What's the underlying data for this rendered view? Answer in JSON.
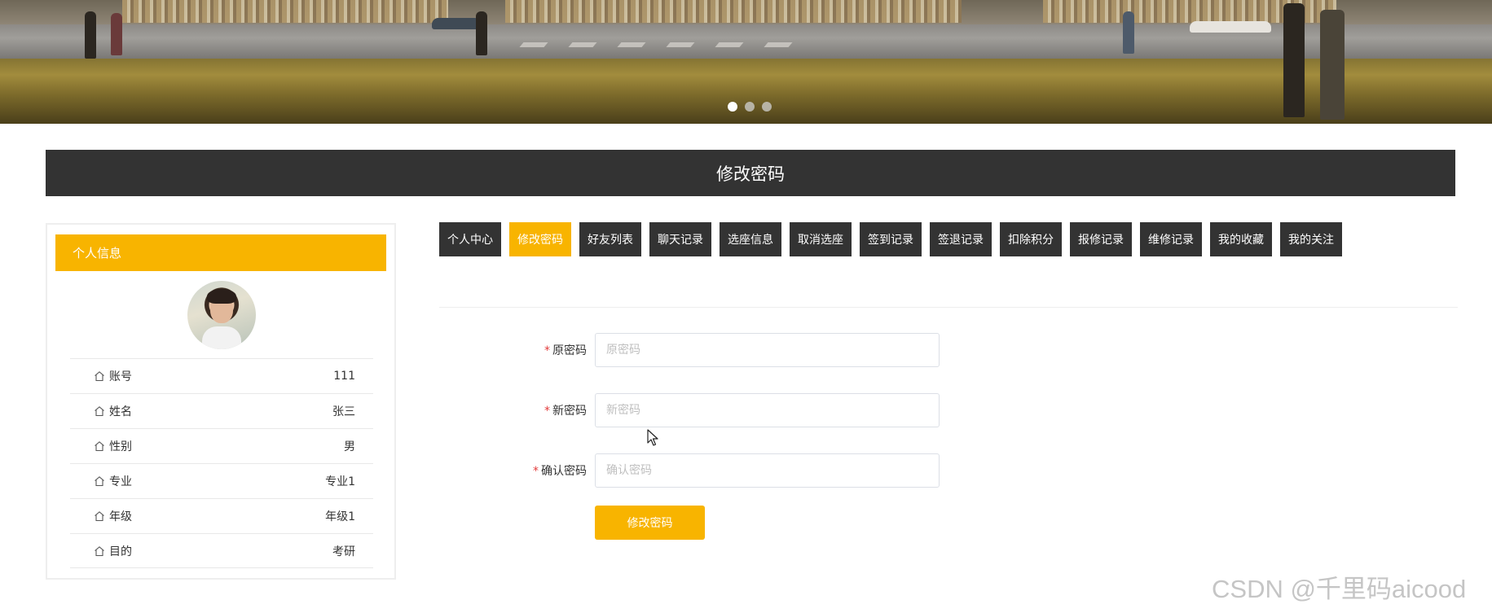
{
  "banner": {
    "slide_count": 3,
    "active_slide": 1
  },
  "page_title": "修改密码",
  "sidebar": {
    "header": "个人信息",
    "info": [
      {
        "label": "账号",
        "value": "111"
      },
      {
        "label": "姓名",
        "value": "张三"
      },
      {
        "label": "性别",
        "value": "男"
      },
      {
        "label": "专业",
        "value": "专业1"
      },
      {
        "label": "年级",
        "value": "年级1"
      },
      {
        "label": "目的",
        "value": "考研"
      }
    ]
  },
  "tabs": [
    {
      "label": "个人中心",
      "active": false
    },
    {
      "label": "修改密码",
      "active": true
    },
    {
      "label": "好友列表",
      "active": false
    },
    {
      "label": "聊天记录",
      "active": false
    },
    {
      "label": "选座信息",
      "active": false
    },
    {
      "label": "取消选座",
      "active": false
    },
    {
      "label": "签到记录",
      "active": false
    },
    {
      "label": "签退记录",
      "active": false
    },
    {
      "label": "扣除积分",
      "active": false
    },
    {
      "label": "报修记录",
      "active": false
    },
    {
      "label": "维修记录",
      "active": false
    },
    {
      "label": "我的收藏",
      "active": false
    },
    {
      "label": "我的关注",
      "active": false
    }
  ],
  "form": {
    "old_password": {
      "label": "原密码",
      "placeholder": "原密码",
      "value": ""
    },
    "new_password": {
      "label": "新密码",
      "placeholder": "新密码",
      "value": ""
    },
    "confirm_password": {
      "label": "确认密码",
      "placeholder": "确认密码",
      "value": ""
    },
    "required_mark": "*",
    "submit_label": "修改密码"
  },
  "watermark": "CSDN @千里码aicood",
  "colors": {
    "accent": "#f8b400",
    "dark": "#333333",
    "required": "#e23c3c"
  }
}
